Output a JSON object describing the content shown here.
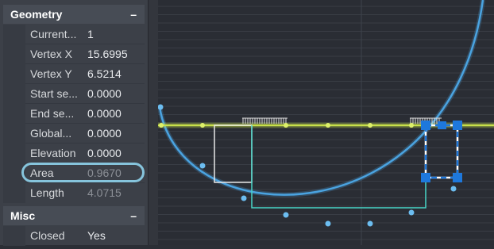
{
  "properties": {
    "geometry": {
      "title": "Geometry",
      "collapse": "–",
      "rows": [
        {
          "name": "Current...",
          "value": "1"
        },
        {
          "name": "Vertex X",
          "value": "15.6995"
        },
        {
          "name": "Vertex Y",
          "value": "6.5214"
        },
        {
          "name": "Start se...",
          "value": "0.0000"
        },
        {
          "name": "End se...",
          "value": "0.0000"
        },
        {
          "name": "Global...",
          "value": "0.0000"
        },
        {
          "name": "Elevation",
          "value": "0.0000"
        },
        {
          "name": "Area",
          "value": "0.9670"
        },
        {
          "name": "Length",
          "value": "4.0715"
        }
      ]
    },
    "misc": {
      "title": "Misc",
      "collapse": "–",
      "rows": [
        {
          "name": "Closed",
          "value": "Yes"
        }
      ]
    }
  },
  "colors": {
    "curve": "#4aa3e0",
    "selected_line": "#c8e04a",
    "polyline": "#48d6c8",
    "grips": "#1e78dc",
    "highlight": "#86c4dc"
  }
}
